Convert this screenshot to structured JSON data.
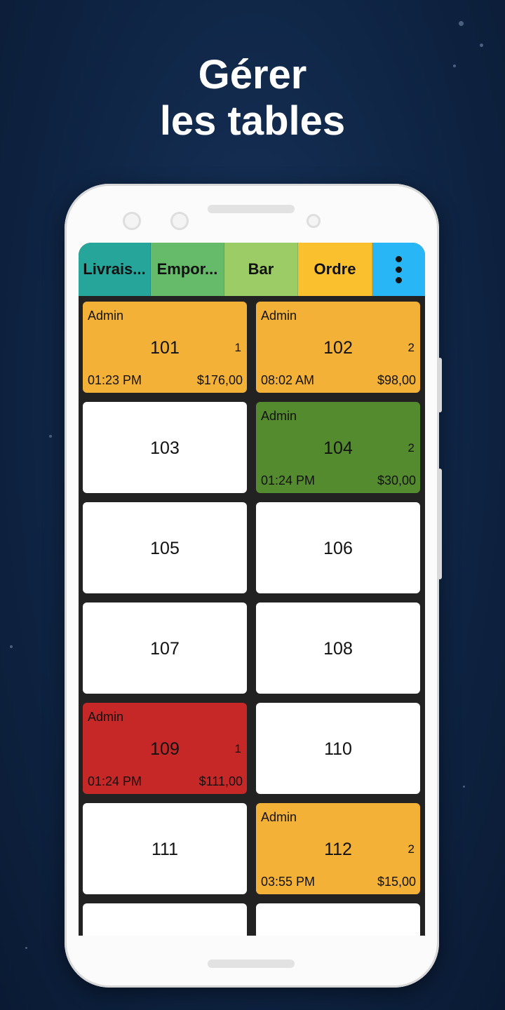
{
  "headline": {
    "line1": "Gérer",
    "line2": "les tables"
  },
  "tabs": [
    {
      "label": "Livrais...",
      "color": "#26a69a"
    },
    {
      "label": "Empor...",
      "color": "#66bb6a"
    },
    {
      "label": "Bar",
      "color": "#9ccc65"
    },
    {
      "label": "Ordre",
      "color": "#fbc02d"
    }
  ],
  "menu_icon": "more-vertical-icon",
  "tables": [
    {
      "number": "101",
      "status": "occupied",
      "color": "#f3b138",
      "user": "Admin",
      "guests": "1",
      "time": "01:23 PM",
      "amount": "$176,00"
    },
    {
      "number": "102",
      "status": "occupied",
      "color": "#f3b138",
      "user": "Admin",
      "guests": "2",
      "time": "08:02 AM",
      "amount": "$98,00"
    },
    {
      "number": "103",
      "status": "free"
    },
    {
      "number": "104",
      "status": "occupied",
      "color": "#558b2f",
      "user": "Admin",
      "guests": "2",
      "time": "01:24 PM",
      "amount": "$30,00"
    },
    {
      "number": "105",
      "status": "free"
    },
    {
      "number": "106",
      "status": "free"
    },
    {
      "number": "107",
      "status": "free"
    },
    {
      "number": "108",
      "status": "free"
    },
    {
      "number": "109",
      "status": "occupied",
      "color": "#c62828",
      "user": "Admin",
      "guests": "1",
      "time": "01:24 PM",
      "amount": "$111,00"
    },
    {
      "number": "110",
      "status": "free"
    },
    {
      "number": "111",
      "status": "free"
    },
    {
      "number": "112",
      "status": "occupied",
      "color": "#f3b138",
      "user": "Admin",
      "guests": "2",
      "time": "03:55 PM",
      "amount": "$15,00"
    },
    {
      "number": "",
      "status": "free"
    },
    {
      "number": "",
      "status": "free"
    }
  ]
}
